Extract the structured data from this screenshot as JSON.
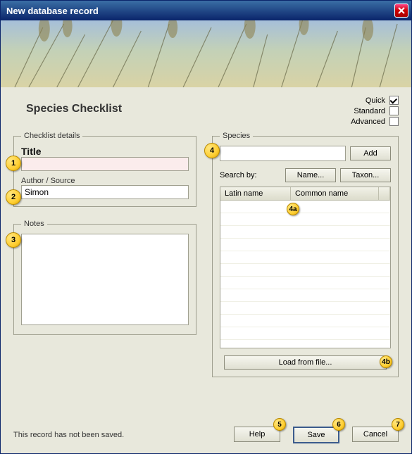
{
  "window": {
    "title": "New database record"
  },
  "heading": "Species Checklist",
  "modes": {
    "quick": "Quick",
    "standard": "Standard",
    "advanced": "Advanced",
    "quick_checked": true,
    "standard_checked": false,
    "advanced_checked": false
  },
  "checklist": {
    "legend": "Checklist details",
    "title_label": "Title",
    "title_value": "",
    "author_label": "Author / Source",
    "author_value": "Simon"
  },
  "notes": {
    "legend": "Notes",
    "value": ""
  },
  "species": {
    "legend": "Species",
    "input_value": "",
    "add": "Add",
    "search_by": "Search by:",
    "name_btn": "Name...",
    "taxon_btn": "Taxon...",
    "col_latin": "Latin name",
    "col_common": "Common name",
    "load": "Load from file..."
  },
  "footer": {
    "status": "This record has not been saved.",
    "help": "Help",
    "save": "Save",
    "cancel": "Cancel"
  },
  "annotations": {
    "n1": "1",
    "n2": "2",
    "n3": "3",
    "n4": "4",
    "n4a": "4a",
    "n4b": "4b",
    "n5": "5",
    "n6": "6",
    "n7": "7"
  }
}
